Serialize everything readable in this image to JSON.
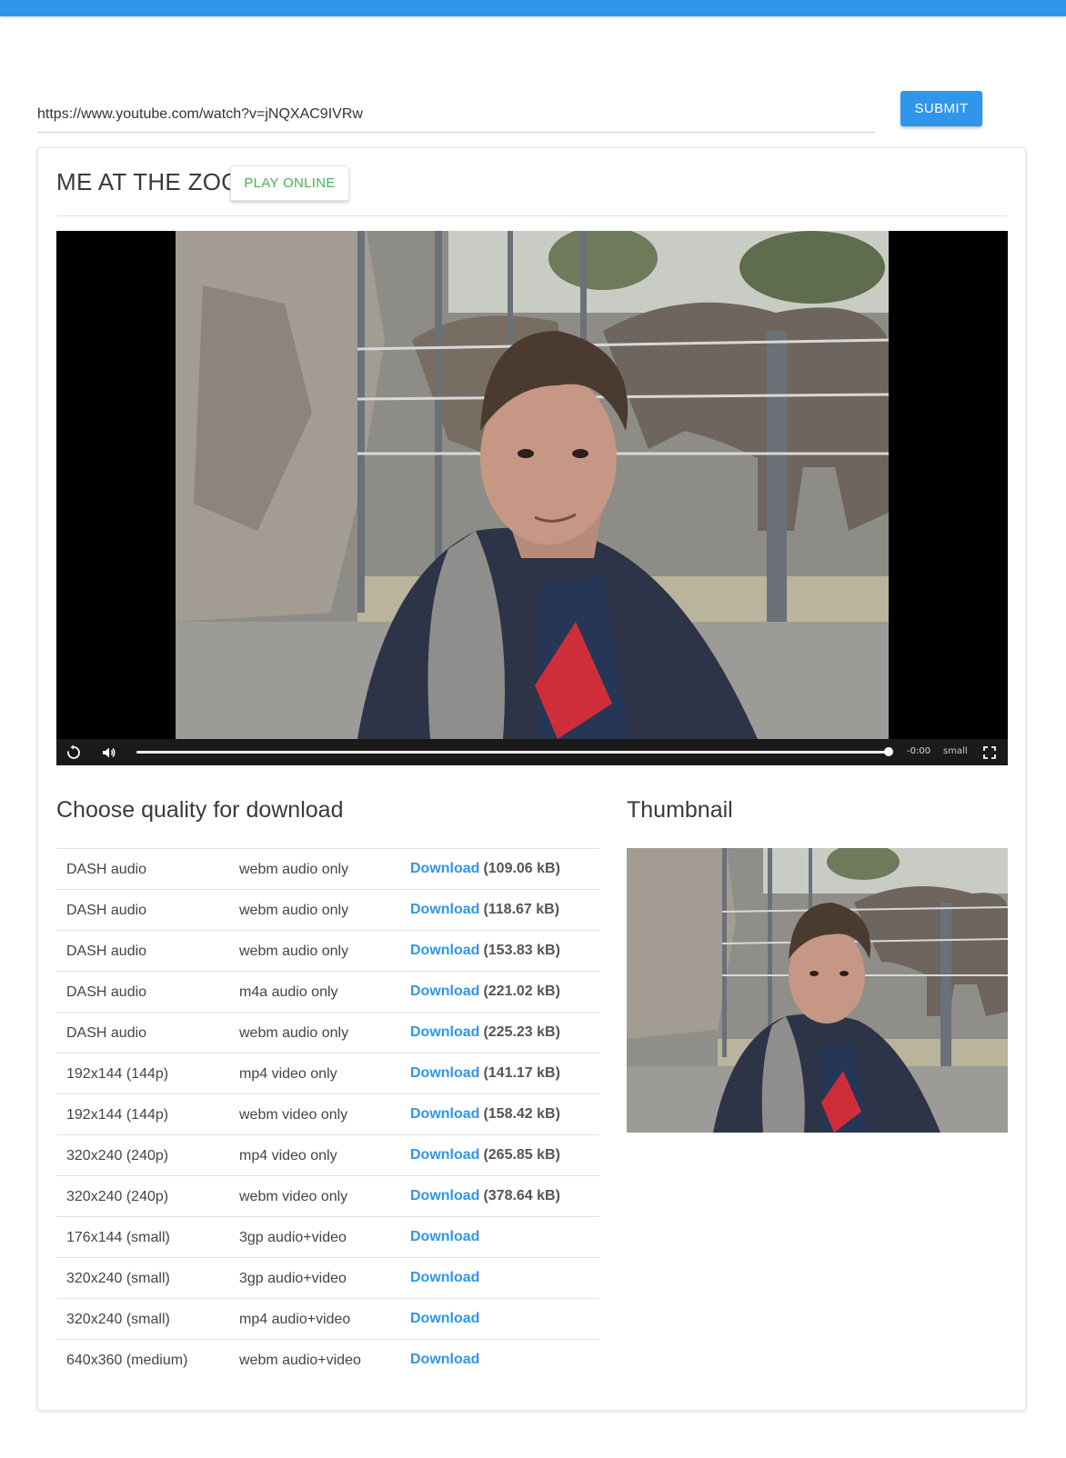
{
  "search": {
    "url_value": "https://www.youtube.com/watch?v=jNQXAC9IVRw",
    "submit_label": "SUBMIT"
  },
  "video": {
    "title": "ME AT THE ZOO",
    "play_online_label": "PLAY ONLINE",
    "player": {
      "time_remaining": "-0:00",
      "quality": "small",
      "progress_fraction": 1.0
    }
  },
  "download_section": {
    "title": "Choose quality for download",
    "link_label": "Download",
    "rows": [
      {
        "quality": "DASH audio",
        "format": "webm audio only",
        "size": "(109.06 kB)"
      },
      {
        "quality": "DASH audio",
        "format": "webm audio only",
        "size": "(118.67 kB)"
      },
      {
        "quality": "DASH audio",
        "format": "webm audio only",
        "size": "(153.83 kB)"
      },
      {
        "quality": "DASH audio",
        "format": "m4a audio only",
        "size": "(221.02 kB)"
      },
      {
        "quality": "DASH audio",
        "format": "webm audio only",
        "size": "(225.23 kB)"
      },
      {
        "quality": "192x144 (144p)",
        "format": "mp4 video only",
        "size": "(141.17 kB)"
      },
      {
        "quality": "192x144 (144p)",
        "format": "webm video only",
        "size": "(158.42 kB)"
      },
      {
        "quality": "320x240 (240p)",
        "format": "mp4 video only",
        "size": "(265.85 kB)"
      },
      {
        "quality": "320x240 (240p)",
        "format": "webm video only",
        "size": "(378.64 kB)"
      },
      {
        "quality": "176x144 (small)",
        "format": "3gp audio+video",
        "size": ""
      },
      {
        "quality": "320x240 (small)",
        "format": "3gp audio+video",
        "size": ""
      },
      {
        "quality": "320x240 (small)",
        "format": "mp4 audio+video",
        "size": ""
      },
      {
        "quality": "640x360 (medium)",
        "format": "webm audio+video",
        "size": ""
      }
    ]
  },
  "thumbnail_section": {
    "title": "Thumbnail"
  },
  "colors": {
    "accent": "#2f96ec",
    "play_online": "#4caf50"
  },
  "icons": [
    "replay-icon",
    "volume-icon",
    "fullscreen-icon"
  ]
}
